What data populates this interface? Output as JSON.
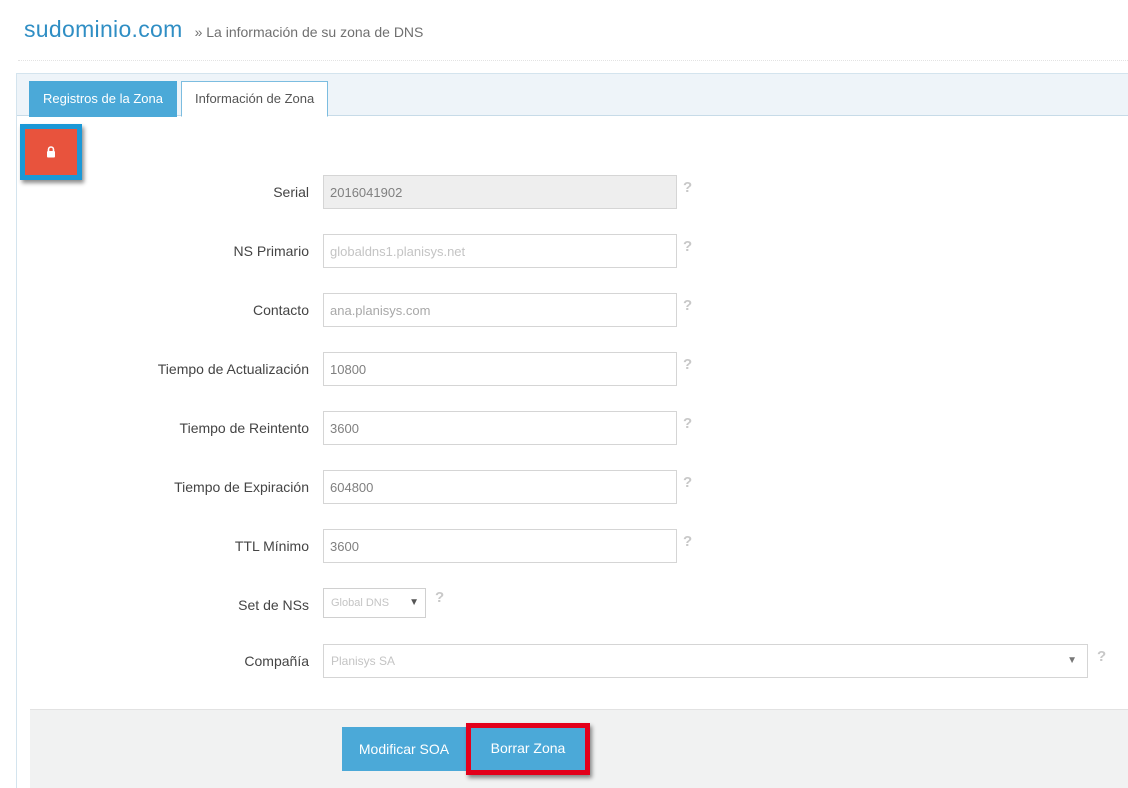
{
  "header": {
    "domain": "sudominio.com",
    "breadcrumb": "» La información de su zona de DNS"
  },
  "tabs": [
    {
      "label": "Registros de la Zona",
      "active": false
    },
    {
      "label": "Información de Zona",
      "active": true
    }
  ],
  "lock_button": {
    "icon": "lock-icon",
    "color": "#e8533d",
    "highlight": "#1b98d6"
  },
  "form": {
    "serial": {
      "label": "Serial",
      "value": "2016041902"
    },
    "ns_primario": {
      "label": "NS Primario",
      "value": "globaldns1.planisys.net"
    },
    "contacto": {
      "label": "Contacto",
      "value": "ana.planisys.com"
    },
    "tiempo_actualizacion": {
      "label": "Tiempo de Actualización",
      "value": "10800"
    },
    "tiempo_reintento": {
      "label": "Tiempo de Reintento",
      "value": "3600"
    },
    "tiempo_expiracion": {
      "label": "Tiempo de Expiración",
      "value": "604800"
    },
    "ttl_minimo": {
      "label": "TTL Mínimo",
      "value": "3600"
    },
    "set_ns": {
      "label": "Set de NSs",
      "value": "Global DNS"
    },
    "compania": {
      "label": "Compañía",
      "value": "Planisys SA"
    },
    "help_glyph": "?"
  },
  "footer": {
    "modificar_label": "Modificar SOA",
    "borrar_label": "Borrar Zona"
  },
  "colors": {
    "accent": "#4ba9d8",
    "title": "#2f8ec4",
    "danger_outline": "#e3001b"
  }
}
